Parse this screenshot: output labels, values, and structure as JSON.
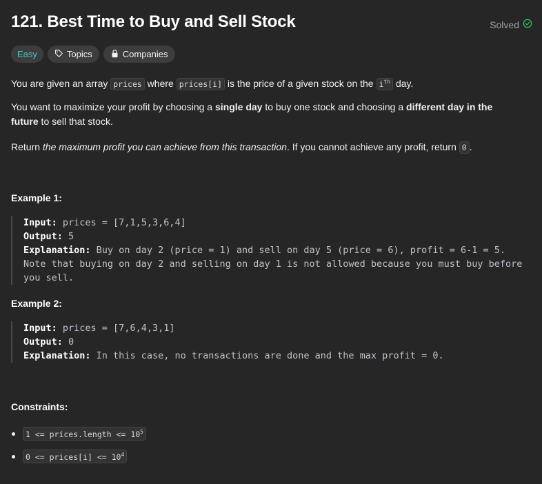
{
  "problem": {
    "title": "121. Best Time to Buy and Sell Stock",
    "status": "Solved",
    "difficulty": "Easy",
    "tags": [
      "Topics",
      "Companies"
    ]
  },
  "description": {
    "p1": {
      "t1": "You are given an array ",
      "c1": "prices",
      "t2": " where ",
      "c2": "prices[i]",
      "t3": " is the price of a given stock on the ",
      "c3": "i",
      "c3sup": "th",
      "t4": " day."
    },
    "p2": {
      "t1": "You want to maximize your profit by choosing a ",
      "b1": "single day",
      "t2": " to buy one stock and choosing a ",
      "b2": "different day in the future",
      "t3": " to sell that stock."
    },
    "p3": {
      "t1": "Return ",
      "i1": "the maximum profit you can achieve from this transaction",
      "t2": ". If you cannot achieve any profit, return ",
      "c1": "0",
      "t3": "."
    }
  },
  "examples": [
    {
      "heading": "Example 1:",
      "input_label": "Input:",
      "input": " prices = [7,1,5,3,6,4]",
      "output_label": "Output:",
      "output": " 5",
      "explanation_label": "Explanation:",
      "explanation": " Buy on day 2 (price = 1) and sell on day 5 (price = 6), profit = 6-1 = 5.\nNote that buying on day 2 and selling on day 1 is not allowed because you must buy before you sell."
    },
    {
      "heading": "Example 2:",
      "input_label": "Input:",
      "input": " prices = [7,6,4,3,1]",
      "output_label": "Output:",
      "output": " 0",
      "explanation_label": "Explanation:",
      "explanation": " In this case, no transactions are done and the max profit = 0."
    }
  ],
  "constraints": {
    "heading": "Constraints:",
    "items": [
      {
        "text": "1 <= prices.length <= 10",
        "sup": "5"
      },
      {
        "text": "0 <= prices[i] <= 10",
        "sup": "4"
      }
    ]
  },
  "colors": {
    "background": "#262626",
    "easy": "#46c6c2",
    "solved_check": "#2cbb5d"
  }
}
